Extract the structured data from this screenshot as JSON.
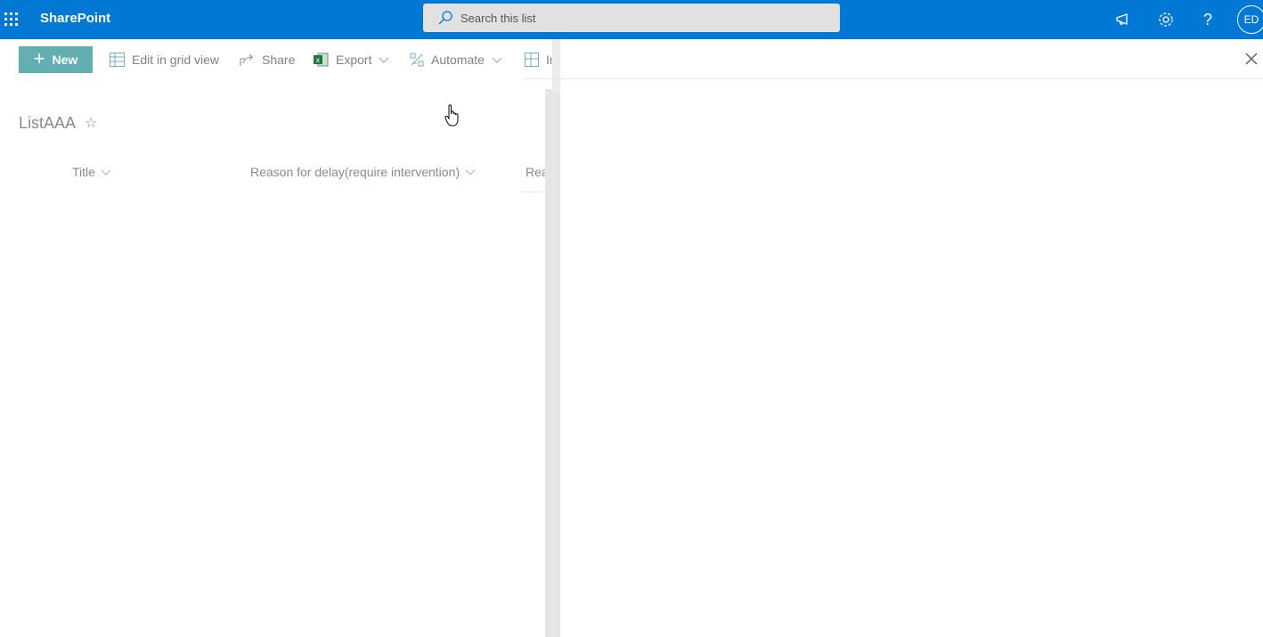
{
  "suite_bar": {
    "brand": "SharePoint",
    "search_placeholder": "Search this list",
    "avatar_initials": "ED",
    "color": "#0078d4"
  },
  "command_bar": {
    "new_label": "New",
    "edit_grid_label": "Edit in grid view",
    "share_label": "Share",
    "export_label": "Export",
    "automate_label": "Automate",
    "integrate_label": "Int",
    "new_color": "#63aeb1"
  },
  "list": {
    "title": "ListAAA",
    "columns": [
      {
        "label": "Title"
      },
      {
        "label": "Reason for delay(require intervention)"
      },
      {
        "label": "Reaso"
      }
    ]
  },
  "icons": [
    "waffle-icon",
    "search-icon",
    "megaphone-icon",
    "gear-icon",
    "help-icon",
    "star-icon",
    "close-icon",
    "grid-icon",
    "share-icon",
    "excel-icon",
    "automate-icon",
    "integrate-icon",
    "chevron-down-icon"
  ]
}
